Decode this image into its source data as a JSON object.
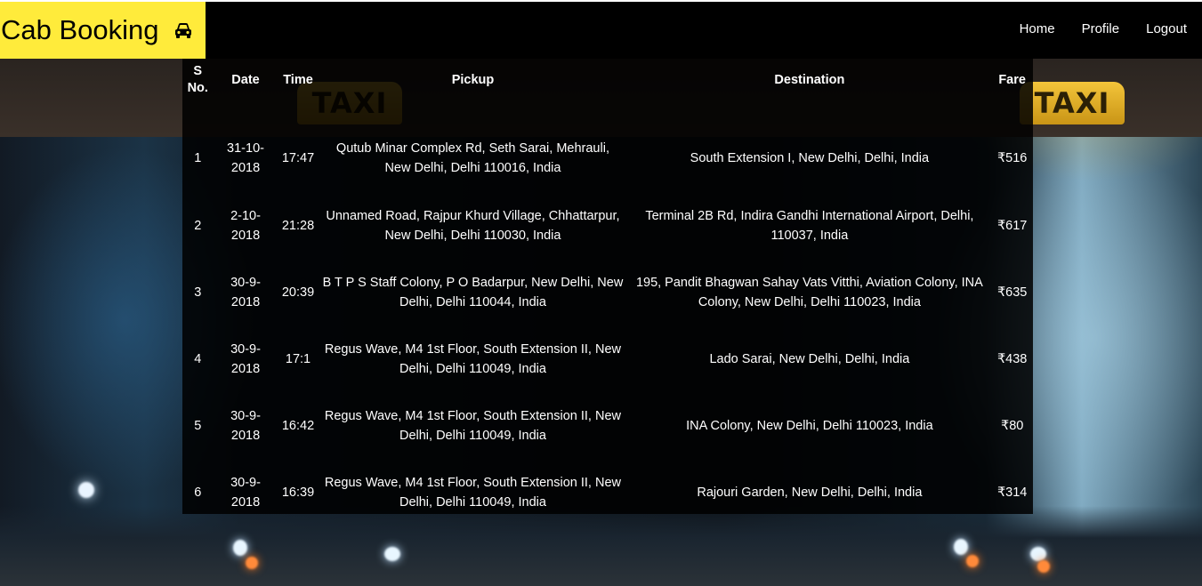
{
  "app": {
    "brand": "Cab Booking",
    "brand_icon": "car-icon",
    "accent_color": "#ffeb3b"
  },
  "nav": {
    "home": "Home",
    "profile": "Profile",
    "logout": "Logout"
  },
  "background": {
    "sign_text": "TAXI"
  },
  "table": {
    "headers": {
      "sno": "S No.",
      "date": "Date",
      "time": "Time",
      "pickup": "Pickup",
      "destination": "Destination",
      "fare": "Fare"
    },
    "rows": [
      {
        "sno": "1",
        "date": "31-10-2018",
        "time": "17:47",
        "pickup": "Qutub Minar Complex Rd, Seth Sarai, Mehrauli, New Delhi, Delhi 110016, India",
        "destination": "South Extension I, New Delhi, Delhi, India",
        "fare": "₹516"
      },
      {
        "sno": "2",
        "date": "2-10-2018",
        "time": "21:28",
        "pickup": "Unnamed Road, Rajpur Khurd Village, Chhattarpur, New Delhi, Delhi 110030, India",
        "destination": "Terminal 2B Rd, Indira Gandhi International Airport, Delhi, 110037, India",
        "fare": "₹617"
      },
      {
        "sno": "3",
        "date": "30-9-2018",
        "time": "20:39",
        "pickup": "B T P S Staff Colony, P O Badarpur, New Delhi, New Delhi, Delhi 110044, India",
        "destination": "195, Pandit Bhagwan Sahay Vats Vitthi, Aviation Colony, INA Colony, New Delhi, Delhi 110023, India",
        "fare": "₹635"
      },
      {
        "sno": "4",
        "date": "30-9-2018",
        "time": "17:1",
        "pickup": "Regus Wave, M4 1st Floor, South Extension II, New Delhi, Delhi 110049, India",
        "destination": "Lado Sarai, New Delhi, Delhi, India",
        "fare": "₹438"
      },
      {
        "sno": "5",
        "date": "30-9-2018",
        "time": "16:42",
        "pickup": "Regus Wave, M4 1st Floor, South Extension II, New Delhi, Delhi 110049, India",
        "destination": "INA Colony, New Delhi, Delhi 110023, India",
        "fare": "₹80"
      },
      {
        "sno": "6",
        "date": "30-9-2018",
        "time": "16:39",
        "pickup": "Regus Wave, M4 1st Floor, South Extension II, New Delhi, Delhi 110049, India",
        "destination": "Rajouri Garden, New Delhi, Delhi, India",
        "fare": "₹314"
      }
    ]
  }
}
